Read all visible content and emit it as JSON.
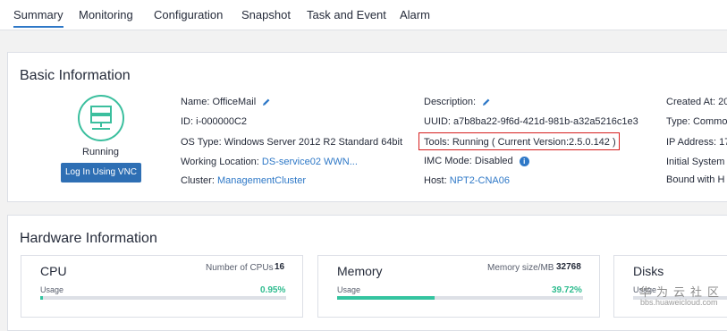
{
  "tabs": [
    {
      "label": "Summary"
    },
    {
      "label": "Monitoring"
    },
    {
      "label": "Configuration"
    },
    {
      "label": "Snapshot"
    },
    {
      "label": "Task and Event"
    },
    {
      "label": "Alarm"
    }
  ],
  "basic": {
    "title": "Basic Information",
    "status": "Running",
    "vnc_button": "Log In Using VNC",
    "name_label": "Name:",
    "name_value": "OfficeMail",
    "id_label": "ID:",
    "id_value": "i-000000C2",
    "os_label": "OS Type:",
    "os_value": "Windows Server 2012 R2 Standard 64bit",
    "location_label": "Working Location:",
    "location_value": "DS-service02  WWN...",
    "cluster_label": "Cluster:",
    "cluster_value": "ManagementCluster",
    "desc_label": "Description:",
    "uuid_label": "UUID:",
    "uuid_value": "a7b8ba22-9f6d-421d-981b-a32a5216c1e3",
    "tools_label": "Tools:",
    "tools_value": "Running ( Current Version:2.5.0.142 )",
    "imc_label": "IMC Mode:",
    "imc_value": "Disabled",
    "host_label": "Host:",
    "host_value": "NPT2-CNA06",
    "created_label": "Created At: 20",
    "type_label": "Type: Commo",
    "ip_label": "IP Address: 17",
    "initial_label": "Initial System",
    "bound_label": "Bound with H"
  },
  "hardware": {
    "title": "Hardware Information",
    "cpu": {
      "title": "CPU",
      "count_label": "Number of CPUs",
      "count_value": "16",
      "usage_label": "Usage",
      "usage_pct": "0.95%",
      "usage_fraction": 0.0095
    },
    "memory": {
      "title": "Memory",
      "size_label": "Memory size/MB",
      "size_value": "32768",
      "usage_label": "Usage",
      "usage_pct": "39.72%",
      "usage_fraction": 0.3972
    },
    "disks": {
      "title": "Disks",
      "usage_label": "Usage"
    }
  },
  "watermark": {
    "text": "华为云社区",
    "url": "bbs.huaweicloud.com"
  },
  "colors": {
    "accent": "#2e78c7",
    "running": "#3bbf9e",
    "highlight_box": "#d61f1f"
  }
}
